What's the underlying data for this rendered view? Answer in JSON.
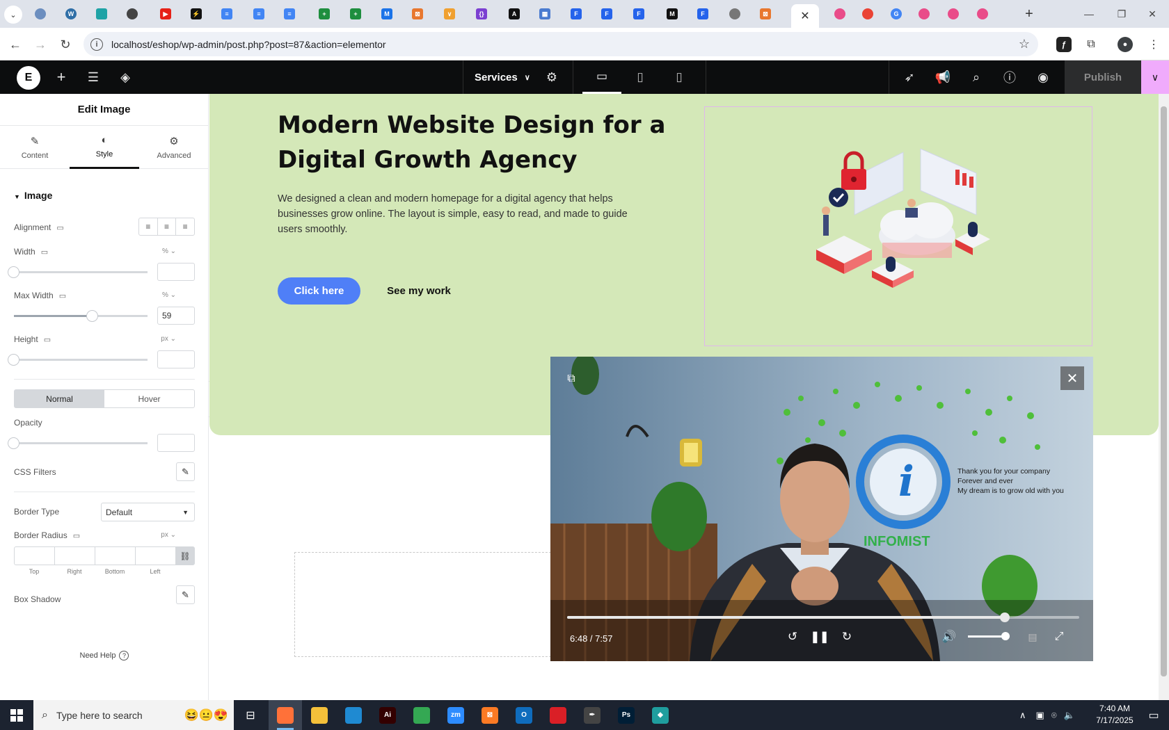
{
  "browser": {
    "url": "localhost/eshop/wp-admin/post.php?post=87&action=elementor",
    "active_tab_close": "✕",
    "new_tab": "+",
    "tab_favicons": [
      {
        "label": "",
        "color": "#6c8ebf",
        "shape": "round"
      },
      {
        "label": "W",
        "color": "#2f6fa7",
        "shape": "round"
      },
      {
        "label": "",
        "color": "#1fa3a6",
        "shape": "square"
      },
      {
        "label": "",
        "color": "#444444",
        "shape": "round"
      },
      {
        "label": "▶",
        "color": "#e62117",
        "shape": "square"
      },
      {
        "label": "⚡",
        "color": "#111111",
        "shape": "square"
      },
      {
        "label": "≡",
        "color": "#4285f4",
        "shape": "square"
      },
      {
        "label": "≡",
        "color": "#4285f4",
        "shape": "square"
      },
      {
        "label": "≡",
        "color": "#4285f4",
        "shape": "square"
      },
      {
        "label": "+",
        "color": "#1e8e3e",
        "shape": "square"
      },
      {
        "label": "+",
        "color": "#1e8e3e",
        "shape": "square"
      },
      {
        "label": "M",
        "color": "#1a73e8",
        "shape": "square"
      },
      {
        "label": "⊠",
        "color": "#e8772e",
        "shape": "square"
      },
      {
        "label": "∨",
        "color": "#f0a030",
        "shape": "square"
      },
      {
        "label": "{}",
        "color": "#7b3fd1",
        "shape": "square"
      },
      {
        "label": "A",
        "color": "#111111",
        "shape": "square"
      },
      {
        "label": "▦",
        "color": "#4a7bd0",
        "shape": "square"
      },
      {
        "label": "F",
        "color": "#2563eb",
        "shape": "square"
      },
      {
        "label": "F",
        "color": "#2563eb",
        "shape": "square"
      },
      {
        "label": "F",
        "color": "#2563eb",
        "shape": "square"
      },
      {
        "label": "M",
        "color": "#111111",
        "shape": "square"
      },
      {
        "label": "F",
        "color": "#2563eb",
        "shape": "square"
      },
      {
        "label": "",
        "color": "#777777",
        "shape": "round"
      },
      {
        "label": "⊠",
        "color": "#e8772e",
        "shape": "square"
      },
      {
        "label": "⊠",
        "color": "#e8772e",
        "shape": "square"
      },
      {
        "label": "",
        "color": "#e94c89",
        "shape": "round"
      },
      {
        "label": "",
        "color": "#ea4335",
        "shape": "round"
      },
      {
        "label": "G",
        "color": "#4285f4",
        "shape": "round"
      },
      {
        "label": "",
        "color": "#e94c89",
        "shape": "round"
      },
      {
        "label": "",
        "color": "#e94c89",
        "shape": "round"
      },
      {
        "label": "",
        "color": "#e94c89",
        "shape": "round"
      }
    ]
  },
  "elementor": {
    "logo": "E",
    "page_name": "Services",
    "publish_label": "Publish"
  },
  "panel": {
    "title": "Edit Image",
    "tabs": [
      {
        "icon": "✎",
        "label": "Content"
      },
      {
        "icon": "◐",
        "label": "Style"
      },
      {
        "icon": "⚙",
        "label": "Advanced"
      }
    ],
    "section_title": "Image",
    "alignment_label": "Alignment",
    "width_label": "Width",
    "width_unit": "% ⌄",
    "width_value": "",
    "max_width_label": "Max Width",
    "max_width_unit": "% ⌄",
    "max_width_value": "59",
    "height_label": "Height",
    "height_unit": "px ⌄",
    "height_value": "",
    "state_normal": "Normal",
    "state_hover": "Hover",
    "opacity_label": "Opacity",
    "opacity_value": "",
    "css_filters_label": "CSS Filters",
    "border_type_label": "Border Type",
    "border_type_value": "Default",
    "border_radius_label": "Border Radius",
    "border_radius_unit": "px ⌄",
    "radius_labels": [
      "Top",
      "Right",
      "Bottom",
      "Left"
    ],
    "box_shadow_label": "Box Shadow",
    "need_help": "Need Help"
  },
  "canvas": {
    "hero_title": "Modern Website Design for a Digital Growth Agency",
    "hero_description": "We designed a clean and modern homepage for a digital agency that helps businesses grow online. The layout is simple, easy to read, and made to guide users smoothly.",
    "primary_button": "Click here",
    "secondary_button": "See my work",
    "hero_bg": "#d4e8b8",
    "button_color": "#4f7ff7"
  },
  "pip": {
    "time": "6:48 / 7:57",
    "progress": 0.855,
    "volume": 0.9,
    "close": "✕",
    "wall_text_1": "Thank you for your company",
    "wall_text_2": "Forever and ever",
    "wall_text_3": "My dream is to grow old with you",
    "logo_text": "INFOMIST"
  },
  "taskbar": {
    "search_placeholder": "Type here to search",
    "clock_time": "7:40 AM",
    "clock_date": "7/17/2025",
    "apps": [
      {
        "name": "firefox",
        "label": "",
        "color": "#ff7139",
        "open": true
      },
      {
        "name": "file-explorer",
        "label": "",
        "color": "#f4c03a",
        "open": false
      },
      {
        "name": "vscode",
        "label": "",
        "color": "#1f8ad2",
        "open": false
      },
      {
        "name": "illustrator",
        "label": "Ai",
        "color": "#330000",
        "open": false
      },
      {
        "name": "chrome",
        "label": "",
        "color": "#34a853",
        "open": false
      },
      {
        "name": "zoom",
        "label": "zm",
        "color": "#2d8cff",
        "open": false
      },
      {
        "name": "xampp",
        "label": "⊠",
        "color": "#fb7a24",
        "open": false
      },
      {
        "name": "outlook",
        "label": "O",
        "color": "#0f6cbd",
        "open": false
      },
      {
        "name": "creative-cloud",
        "label": "",
        "color": "#da1f26",
        "open": false
      },
      {
        "name": "pen-tool",
        "label": "✒",
        "color": "#444444",
        "open": false
      },
      {
        "name": "photoshop",
        "label": "Ps",
        "color": "#001e36",
        "open": false
      },
      {
        "name": "app-diamond",
        "label": "◆",
        "color": "#1f9e9e",
        "open": false
      }
    ]
  }
}
